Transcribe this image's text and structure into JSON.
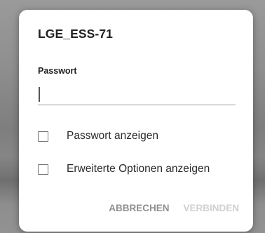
{
  "dialog": {
    "title": "LGE_ESS-71",
    "password_label": "Passwort",
    "password_value": "",
    "options": [
      {
        "label": "Passwort anzeigen",
        "checked": false
      },
      {
        "label": "Erweiterte Optionen anzeigen",
        "checked": false
      }
    ],
    "actions": {
      "cancel_label": "ABBRECHEN",
      "connect_label": "VERBINDEN",
      "connect_enabled": false
    }
  },
  "colors": {
    "background_dim": "#8c8c8c",
    "dialog_bg": "#ffffff",
    "text_primary": "#212121",
    "button_enabled": "#8f8f8f",
    "button_disabled": "#d0d0d0",
    "underline": "#9e9e9e"
  }
}
